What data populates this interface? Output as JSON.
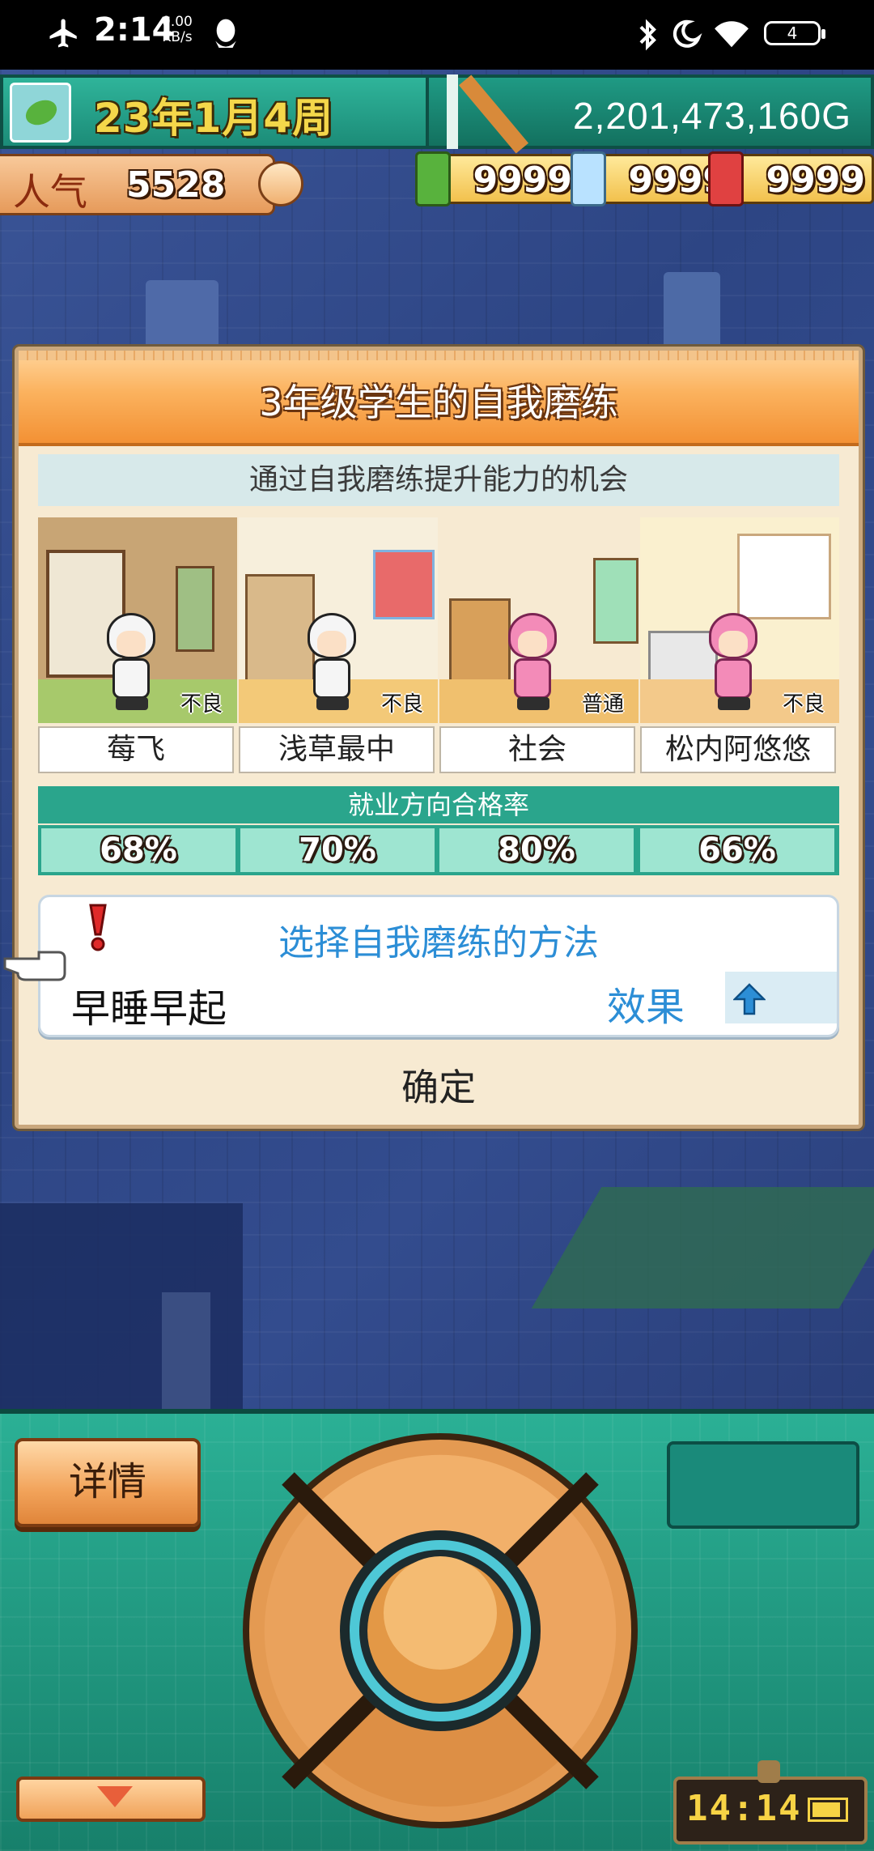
{
  "status_bar": {
    "time": "2:14",
    "net_speed_value": "0.00",
    "net_speed_unit": "KB/s",
    "battery": "4",
    "icons": [
      "airplane-icon",
      "qq-penguin-icon",
      "bluetooth-icon",
      "moon-icon",
      "wifi-icon",
      "battery-icon"
    ]
  },
  "hud": {
    "date": "23年1月4周",
    "money": "2,201,473,160G",
    "popularity_label": "人气",
    "popularity_value": "5528",
    "resources": [
      {
        "icon": "green-leaf-icon",
        "value": "9999",
        "color": "#58b23d"
      },
      {
        "icon": "flask-icon",
        "value": "9999",
        "color": "#9ad0ff"
      },
      {
        "icon": "red-book-icon",
        "value": "9999",
        "color": "#e04141"
      }
    ]
  },
  "dialog": {
    "title": "3年级学生的自我磨练",
    "subtitle": "通过自我磨练提升能力的机会",
    "students": [
      {
        "name": "莓飞",
        "status": "不良",
        "outfit": "panda"
      },
      {
        "name": "浅草最中",
        "status": "不良",
        "outfit": "panda"
      },
      {
        "name": "社会",
        "status": "普通",
        "outfit": "pink"
      },
      {
        "name": "松内阿悠悠",
        "status": "不良",
        "outfit": "pink"
      }
    ],
    "rate_title": "就业方向合格率",
    "rates": [
      "68%",
      "70%",
      "80%",
      "66%"
    ],
    "method_title": "选择自我磨练的方法",
    "method_value": "早睡早起",
    "effect_label": "效果",
    "confirm": "确定"
  },
  "controls": {
    "details": "详情",
    "clock": "14:14"
  },
  "colors": {
    "accent_teal": "#2aa58c",
    "accent_orange": "#f39134",
    "method_blue": "#2c8ed6"
  }
}
